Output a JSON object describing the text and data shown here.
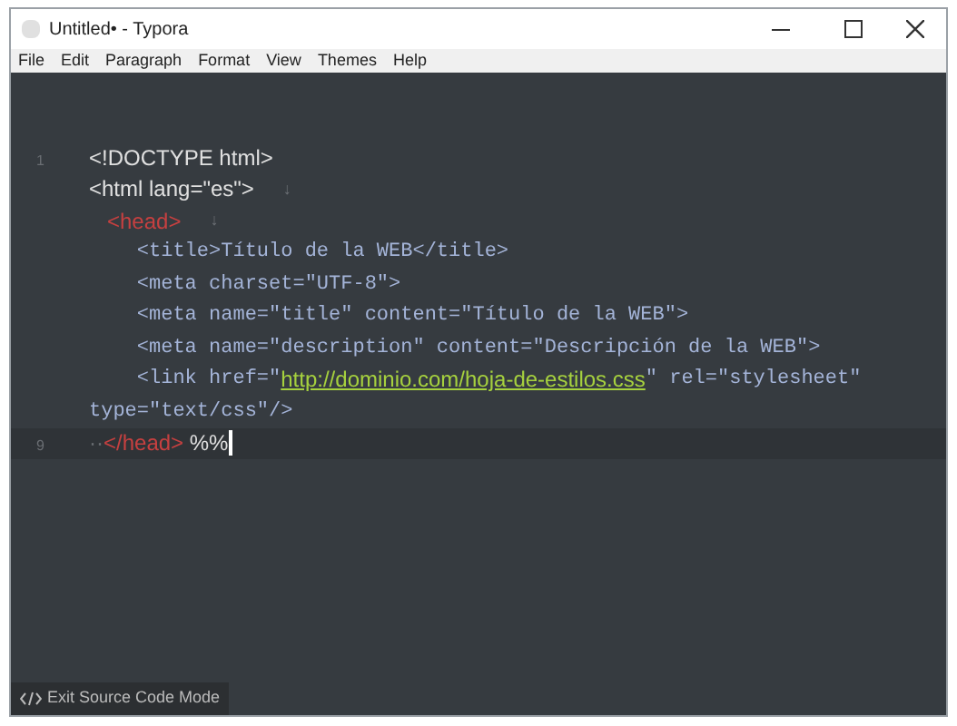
{
  "window": {
    "title": "Untitled• - Typora"
  },
  "menu": [
    "File",
    "Edit",
    "Paragraph",
    "Format",
    "View",
    "Themes",
    "Help"
  ],
  "lines": [
    {
      "number": "1",
      "current": false,
      "segments": [
        {
          "kind": "plain",
          "text": "<!DOCTYPE html>"
        }
      ]
    },
    {
      "current": false,
      "segments": [
        {
          "kind": "plain",
          "text": "<html lang=\"es\">"
        },
        {
          "kind": "mark",
          "text": "↓"
        }
      ]
    },
    {
      "current": false,
      "segments": [
        {
          "kind": "tag",
          "text": "   <head>"
        },
        {
          "kind": "mark",
          "text": "↓"
        }
      ]
    },
    {
      "current": false,
      "segments": [
        {
          "kind": "code",
          "text": "    <title>Título de la WEB</title>"
        }
      ]
    },
    {
      "current": false,
      "segments": [
        {
          "kind": "code",
          "text": "    <meta charset=\"UTF-8\">"
        }
      ]
    },
    {
      "current": false,
      "segments": [
        {
          "kind": "code",
          "text": "    <meta name=\"title\" content=\"Título de la WEB\">"
        }
      ]
    },
    {
      "current": false,
      "segments": [
        {
          "kind": "code",
          "text": "    <meta name=\"description\" content=\"Descripción de la WEB\">"
        }
      ]
    },
    {
      "current": false,
      "segments": [
        {
          "kind": "code",
          "text": "    <link href=\""
        },
        {
          "kind": "link",
          "text": "http://dominio.com/hoja-de-estilos.css"
        },
        {
          "kind": "code",
          "text": "\" rel=\"stylesheet\""
        }
      ]
    },
    {
      "current": false,
      "segments": [
        {
          "kind": "code",
          "text": "type=\"text/css\"/>"
        }
      ]
    },
    {
      "number": "9",
      "current": true,
      "segments": [
        {
          "kind": "dots",
          "text": "··"
        },
        {
          "kind": "tag",
          "text": "</head>"
        },
        {
          "kind": "plain",
          "text": " %%"
        }
      ]
    }
  ],
  "footer": {
    "button": "Exit Source Code Mode"
  }
}
